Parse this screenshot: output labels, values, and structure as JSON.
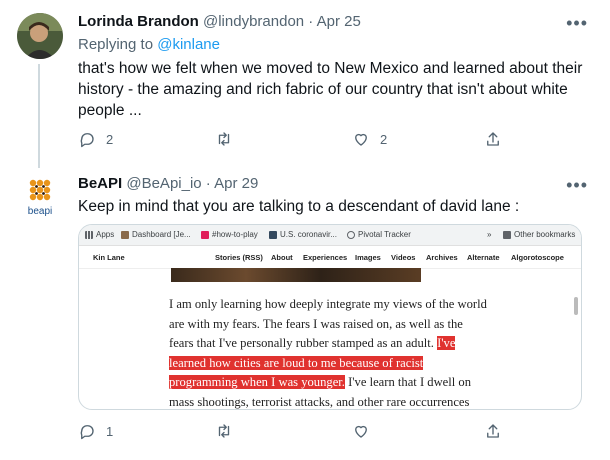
{
  "tweet1": {
    "name": "Lorinda Brandon",
    "handle_date": "@lindybrandon · Apr 25",
    "replying_prefix": "Replying to ",
    "replying_handle": "@kinlane",
    "text": "that's how we felt when we moved to New Mexico and learned about their history - the amazing and rich fabric of our country that isn't about white people ...",
    "reply_count": "2",
    "retweet_count": "",
    "like_count": "2"
  },
  "tweet2": {
    "name": "BeAPI",
    "handle_date": "@BeApi_io · Apr 29",
    "avatar_text": "beapi",
    "text": "Keep in mind that you are talking to a descendant of david lane :",
    "reply_count": "1",
    "retweet_count": "",
    "like_count": ""
  },
  "embed": {
    "bookmarks": [
      "Apps",
      "Dashboard [Je...",
      "#how-to-play",
      "U.S. coronavir...",
      "Pivotal Tracker"
    ],
    "bookmarks_more": "»",
    "other_bookmarks": "Other bookmarks",
    "site_title": "Kin Lane",
    "nav": [
      "Stories (RSS)",
      "About",
      "Experiences",
      "Images",
      "Videos",
      "Archives",
      "Alternate",
      "Algorotoscope"
    ],
    "article_lines": [
      "I am only learning how deeply integrate my views of the world",
      "are with my fears. The fears I was raised on, as well as the",
      "fears that I've personally rubber stamped as an adult.",
      "I've",
      "learned how cities are loud to me because of racist",
      "programming when I was younger.",
      "I've learn that I dwell on",
      "mass shootings, terrorist attacks, and other rare occurrences"
    ]
  },
  "colors": {
    "link": "#1d9bf0",
    "muted": "#536471",
    "highlight": "#e0322f"
  },
  "icons": [
    "reply-icon",
    "retweet-icon",
    "like-icon",
    "share-icon",
    "more-icon"
  ]
}
